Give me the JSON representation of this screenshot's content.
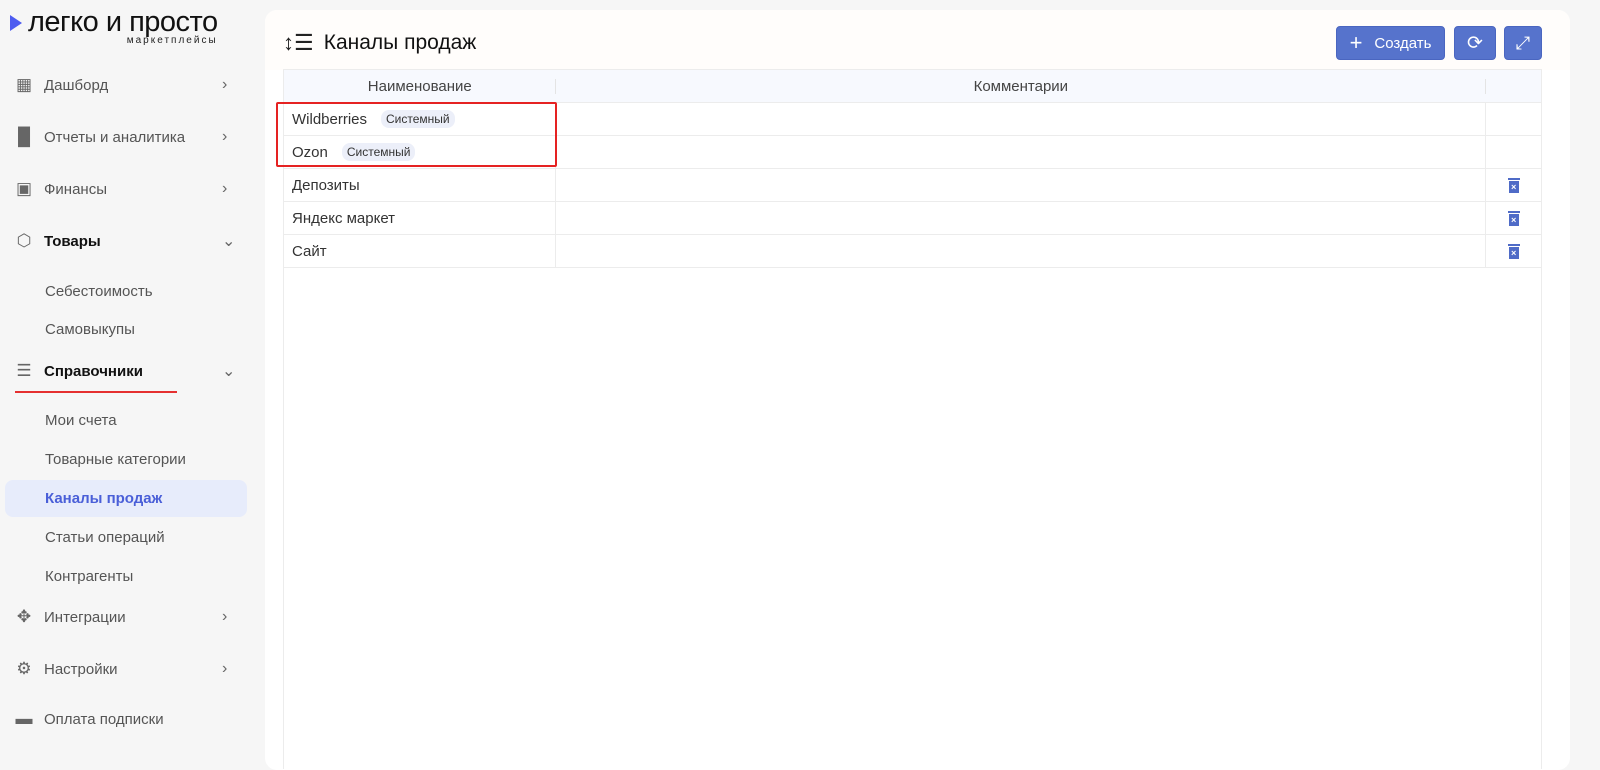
{
  "logo": {
    "main": "легко и просто",
    "sub": "маркетплейсы"
  },
  "sidebar": {
    "dashboard": "Дашборд",
    "reports": "Отчеты и аналитика",
    "finance": "Финансы",
    "goods": "Товары",
    "cost": "Себестоимость",
    "selfbuy": "Самовыкупы",
    "refs": "Справочники",
    "accounts": "Мои счета",
    "categories": "Товарные категории",
    "channels": "Каналы продаж",
    "operations": "Статьи операций",
    "contractors": "Контрагенты",
    "integrations": "Интеграции",
    "settings": "Настройки",
    "payment": "Оплата подписки"
  },
  "page": {
    "title": "Каналы продаж",
    "create_label": "Создать"
  },
  "table": {
    "headers": [
      "Наименование",
      "Комментарии"
    ],
    "rows": [
      {
        "name": "Wildberries",
        "badge": "Системный",
        "comment": ""
      },
      {
        "name": "Ozon",
        "badge": "Системный",
        "comment": ""
      },
      {
        "name": "Депозиты",
        "comment": ""
      },
      {
        "name": "Яндекс маркет",
        "comment": ""
      },
      {
        "name": "Сайт",
        "comment": ""
      }
    ]
  },
  "colors": {
    "accent": "#5673cc",
    "active_text": "#4a5fd8",
    "highlight": "#e52222"
  }
}
